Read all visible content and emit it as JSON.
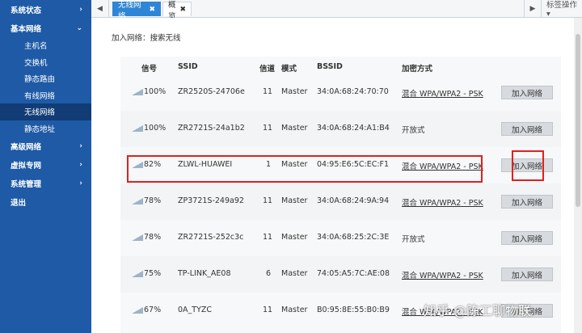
{
  "sidebar": {
    "groups": [
      {
        "label": "系统状态",
        "chev": "›"
      },
      {
        "label": "基本网络",
        "chev": "⌄"
      },
      {
        "label": "高级网络",
        "chev": "›"
      },
      {
        "label": "虚拟专网",
        "chev": "›"
      },
      {
        "label": "系统管理",
        "chev": "›"
      },
      {
        "label": "退出"
      }
    ],
    "basic_items": [
      "主机名",
      "交换机",
      "静态路由",
      "有线网络",
      "无线网络",
      "静态地址"
    ],
    "active_item": "无线网络"
  },
  "tabs": {
    "nav_left": "◀",
    "nav_right": "▶",
    "items": [
      {
        "label": "无线网络",
        "close": "✖"
      },
      {
        "label": "概览",
        "close": "✖"
      }
    ],
    "ops_label": "标签操作 ▾"
  },
  "breadcrumb": "加入网络：搜索无线",
  "table": {
    "headers": {
      "signal": "信号",
      "ssid": "SSID",
      "channel": "信道",
      "mode": "模式",
      "bssid": "BSSID",
      "encryption": "加密方式"
    },
    "join_label": "加入网络",
    "rows": [
      {
        "signal": "100%",
        "ssid": "ZR2520S-24706e",
        "channel": "11",
        "mode": "Master",
        "bssid": "34:0A:68:24:70:70",
        "encryption": "混合 WPA/WPA2 - PSK"
      },
      {
        "signal": "100%",
        "ssid": "ZR2721S-24a1b2",
        "channel": "11",
        "mode": "Master",
        "bssid": "34:0A:68:24:A1:B4",
        "encryption": "开放式"
      },
      {
        "signal": "82%",
        "ssid": "ZLWL-HUAWEI",
        "channel": "1",
        "mode": "Master",
        "bssid": "04:95:E6:5C:EC:F1",
        "encryption": "混合 WPA/WPA2 - PSK"
      },
      {
        "signal": "78%",
        "ssid": "ZP3721S-249a92",
        "channel": "11",
        "mode": "Master",
        "bssid": "34:0A:68:24:9A:94",
        "encryption": "混合 WPA/WPA2 - PSK"
      },
      {
        "signal": "78%",
        "ssid": "ZR2721S-252c3c",
        "channel": "11",
        "mode": "Master",
        "bssid": "34:0A:68:25:2C:3E",
        "encryption": "开放式"
      },
      {
        "signal": "75%",
        "ssid": "TP-LINK_AE08",
        "channel": "6",
        "mode": "Master",
        "bssid": "74:05:A5:7C:AE:08",
        "encryption": "混合 WPA/WPA2 - PSK"
      },
      {
        "signal": "67%",
        "ssid": "0A_TYZC",
        "channel": "11",
        "mode": "Master",
        "bssid": "B0:95:8E:55:B0:B9",
        "encryption": "混合 WPA/WPA2 - PSK"
      }
    ]
  },
  "watermark": "知乎 @陈工聊物联",
  "colors": {
    "sidebar": "#1e5aa6",
    "active_tab": "#2f86d6",
    "highlight": "#e02020"
  }
}
